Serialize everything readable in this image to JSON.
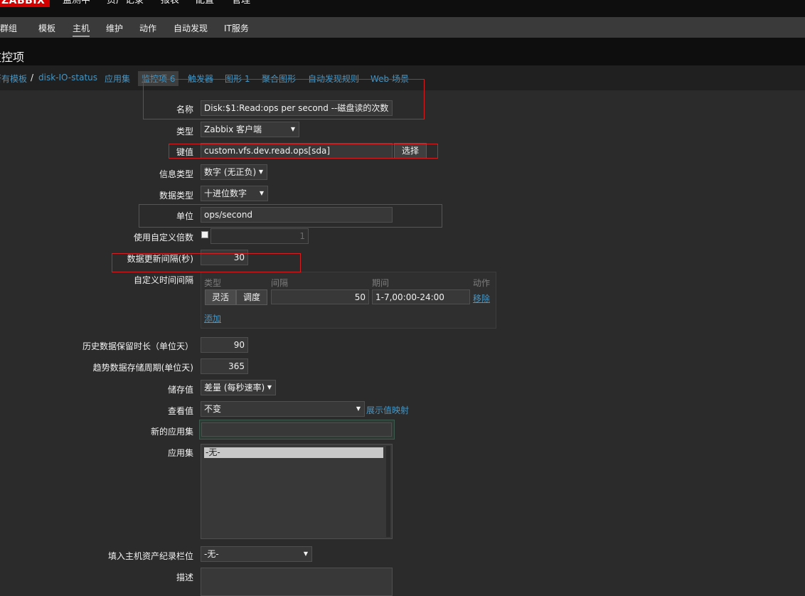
{
  "topnav": {
    "logo": "ZABBIX",
    "items": [
      "监测中",
      "资产记录",
      "报表",
      "配置",
      "管理"
    ]
  },
  "subnav": {
    "items": [
      "机群组",
      "模板",
      "主机",
      "维护",
      "动作",
      "自动发现",
      "IT服务"
    ],
    "active": "主机"
  },
  "page_title": "监控项",
  "breadcrumb": {
    "all_templates": "所有模板",
    "separator": "/",
    "host": "disk-IO-status",
    "tabs": [
      "应用集",
      "监控项 6",
      "触发器",
      "图形 1",
      "聚合图形",
      "自动发现规则",
      "Web 场景"
    ],
    "current_tab": "监控项 6"
  },
  "form": {
    "name_label": "名称",
    "name_value": "Disk:$1:Read:ops per second --磁盘读的次数",
    "type_label": "类型",
    "type_value": "Zabbix 客户端",
    "key_label": "键值",
    "key_value": "custom.vfs.dev.read.ops[sda]",
    "key_select_button": "选择",
    "info_type_label": "信息类型",
    "info_type_value": "数字 (无正负)",
    "data_type_label": "数据类型",
    "data_type_value": "十进位数字",
    "units_label": "单位",
    "units_value": "ops/second",
    "multiplier_label": "使用自定义倍数",
    "multiplier_value": "1",
    "multiplier_checked": false,
    "interval_label": "数据更新间隔(秒)",
    "interval_value": "30",
    "custom_intervals_label": "自定义时间间隔",
    "custom_intervals": {
      "headers": [
        "类型",
        "间隔",
        "期间",
        "动作"
      ],
      "row": {
        "type_flexible": "灵活",
        "type_scheduling": "调度",
        "interval": "50",
        "period": "1-7,00:00-24:00",
        "remove": "移除"
      },
      "add": "添加"
    },
    "history_label": "历史数据保留时长（单位天）",
    "history_value": "90",
    "trends_label": "趋势数据存储周期(单位天)",
    "trends_value": "365",
    "store_value_label": "储存值",
    "store_value_value": "差量 (每秒速率)",
    "show_value_label": "查看值",
    "show_value_value": "不变",
    "show_value_mapping_link": "展示值映射",
    "new_app_label": "新的应用集",
    "new_app_value": "",
    "apps_label": "应用集",
    "apps_options": [
      "-无-"
    ],
    "inventory_label": "填入主机资产纪录栏位",
    "inventory_value": "-无-",
    "description_label": "描述"
  },
  "colors": {
    "accent_link": "#4796c4",
    "logo_red": "#d40000",
    "annotation_red": "#d42020"
  }
}
